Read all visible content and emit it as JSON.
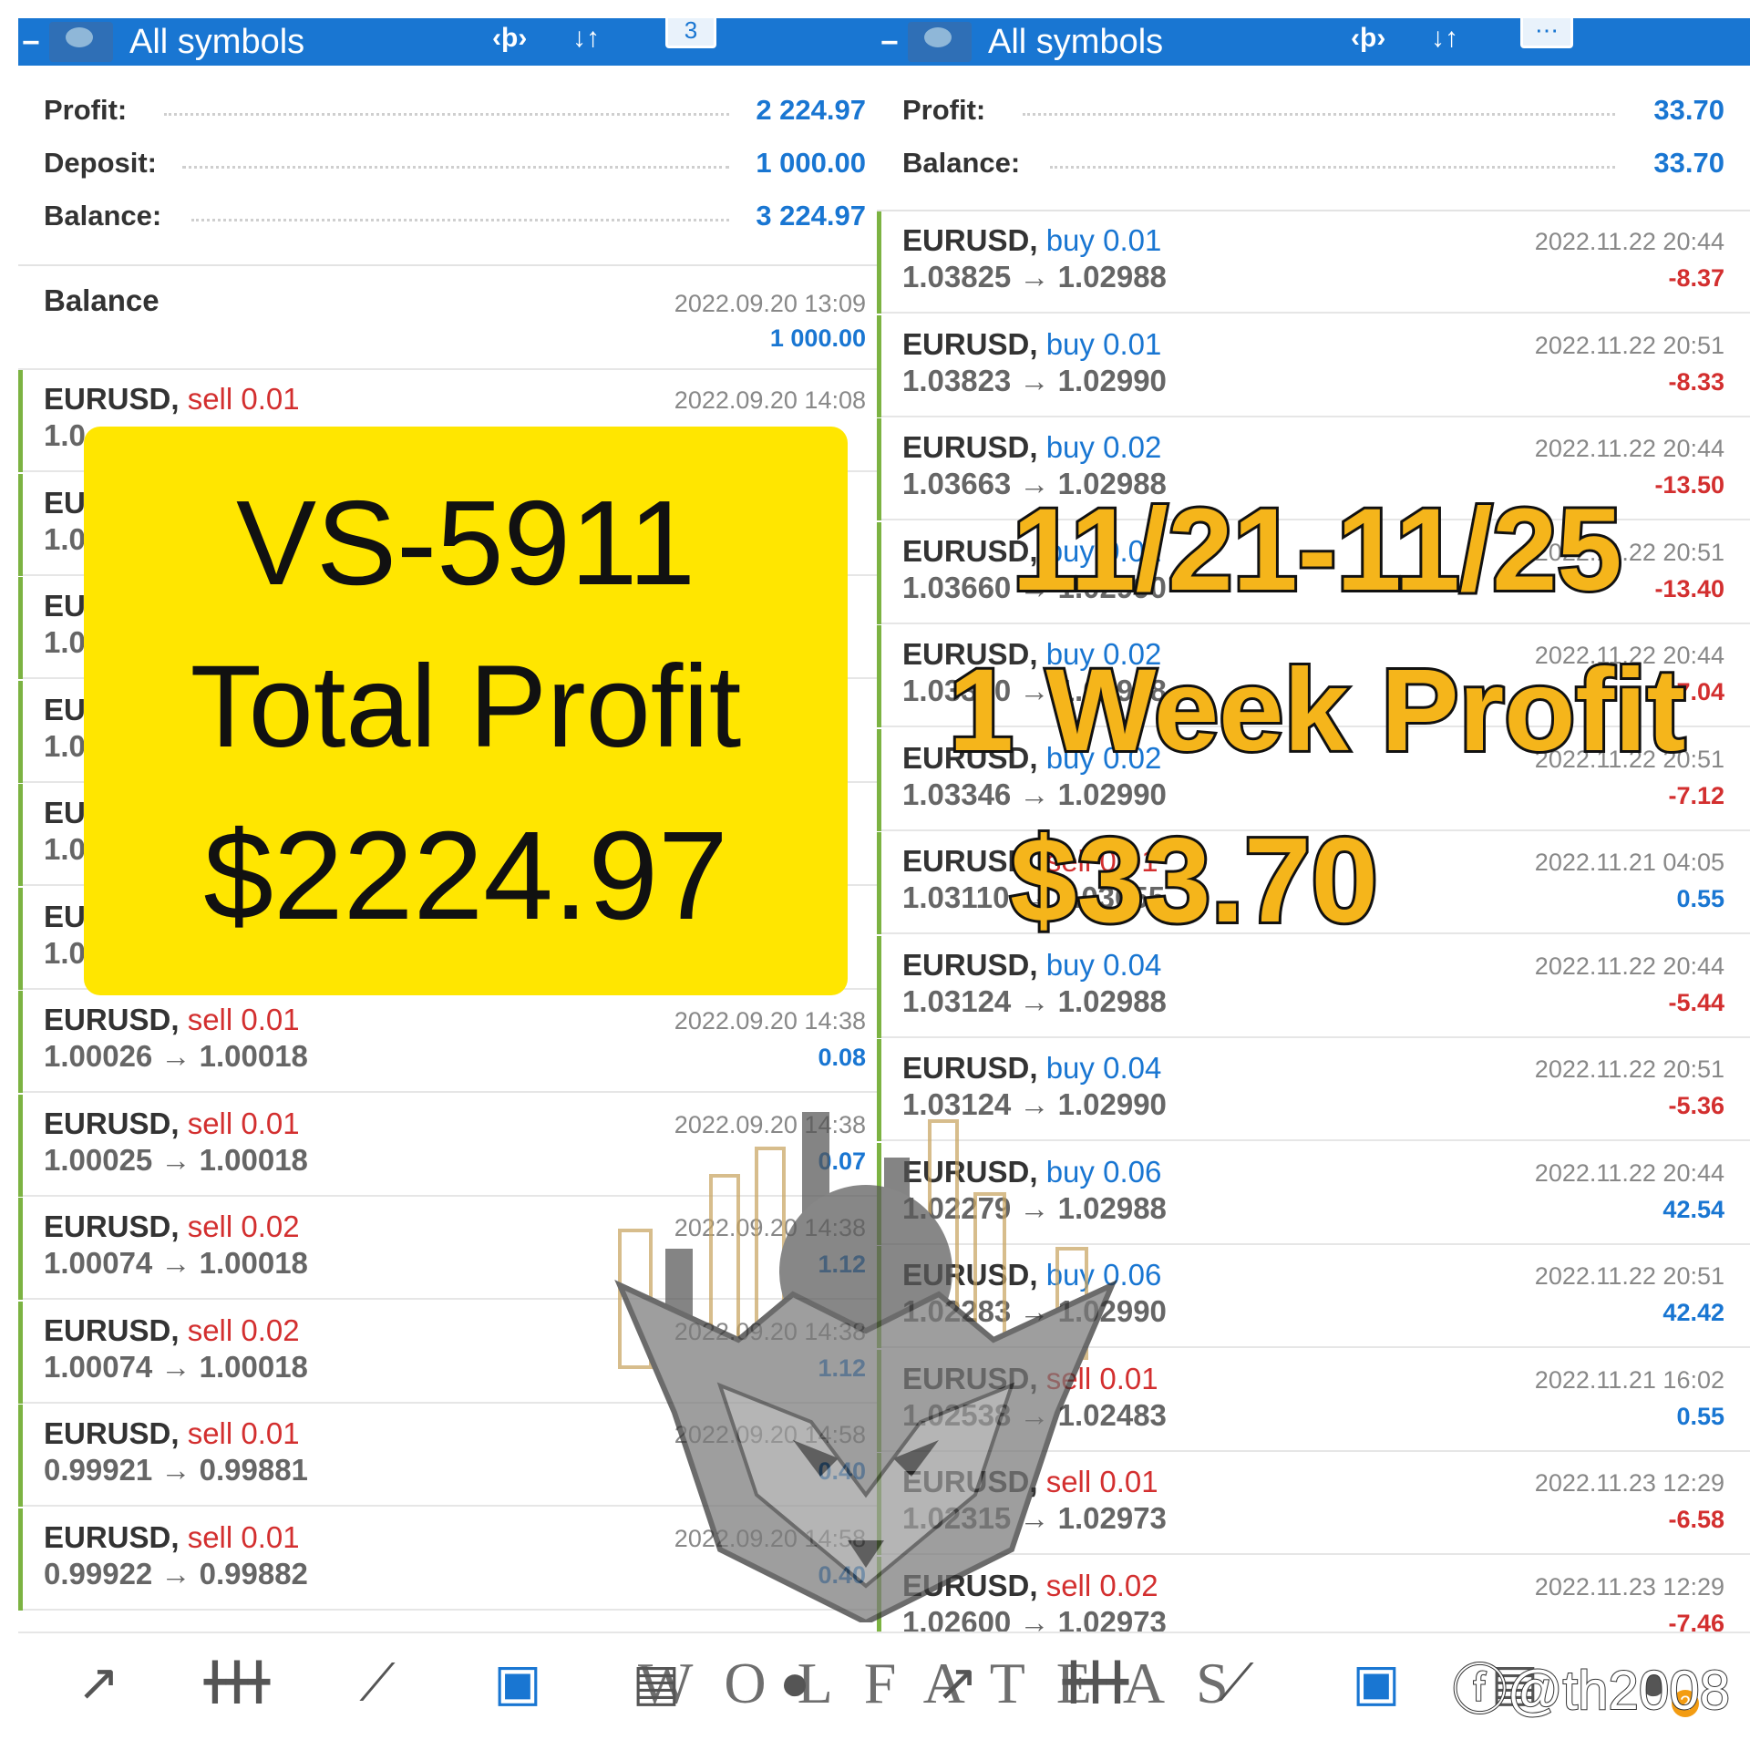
{
  "left": {
    "title": "All symbols",
    "badge": "3",
    "summary": [
      {
        "label": "Profit:",
        "value": "2 224.97"
      },
      {
        "label": "Deposit:",
        "value": "1 000.00"
      },
      {
        "label": "Balance:",
        "value": "3 224.97"
      }
    ],
    "balance_entry": {
      "label": "Balance",
      "time": "2022.09.20 13:09",
      "amount": "1 000.00"
    },
    "rows": [
      {
        "symbol": "EURUSD,",
        "side": "sell",
        "lot": "0.01",
        "prices": "1.0",
        "time": "2022.09.20 14:08",
        "profit": ""
      },
      {
        "symbol": "EU",
        "side": "",
        "lot": "",
        "prices": "1.0",
        "time": "",
        "profit": ""
      },
      {
        "symbol": "EU",
        "side": "",
        "lot": "",
        "prices": "1.0",
        "time": "",
        "profit": ""
      },
      {
        "symbol": "EU",
        "side": "",
        "lot": "",
        "prices": "1.0",
        "time": "",
        "profit": ""
      },
      {
        "symbol": "EU",
        "side": "",
        "lot": "",
        "prices": "1.0",
        "time": "",
        "profit": ""
      },
      {
        "symbol": "EU",
        "side": "",
        "lot": "",
        "prices": "1.0",
        "time": "",
        "profit": ""
      },
      {
        "symbol": "EURUSD,",
        "side": "sell",
        "lot": "0.01",
        "prices": "1.00026 → 1.00018",
        "time": "2022.09.20 14:38",
        "profit": "0.08"
      },
      {
        "symbol": "EURUSD,",
        "side": "sell",
        "lot": "0.01",
        "prices": "1.00025 → 1.00018",
        "time": "2022.09.20 14:38",
        "profit": "0.07"
      },
      {
        "symbol": "EURUSD,",
        "side": "sell",
        "lot": "0.02",
        "prices": "1.00074 → 1.00018",
        "time": "2022.09.20 14:38",
        "profit": "1.12"
      },
      {
        "symbol": "EURUSD,",
        "side": "sell",
        "lot": "0.02",
        "prices": "1.00074 → 1.00018",
        "time": "2022.09.20 14:38",
        "profit": "1.12"
      },
      {
        "symbol": "EURUSD,",
        "side": "sell",
        "lot": "0.01",
        "prices": "0.99921 → 0.99881",
        "time": "2022.09.20 14:58",
        "profit": "0.40"
      },
      {
        "symbol": "EURUSD,",
        "side": "sell",
        "lot": "0.01",
        "prices": "0.99922 → 0.99882",
        "time": "2022.09.20 14:58",
        "profit": "0.40"
      }
    ],
    "nav": [
      "↗",
      "┃┃┃",
      "⟋",
      "▣",
      "▤",
      "●"
    ]
  },
  "right": {
    "title": "All symbols",
    "summary": [
      {
        "label": "Profit:",
        "value": "33.70"
      },
      {
        "label": "Balance:",
        "value": "33.70"
      }
    ],
    "rows": [
      {
        "symbol": "EURUSD,",
        "side": "buy",
        "lot": "0.01",
        "prices": "1.03825 → 1.02988",
        "time": "2022.11.22 20:44",
        "profit": "-8.37"
      },
      {
        "symbol": "EURUSD,",
        "side": "buy",
        "lot": "0.01",
        "prices": "1.03823 → 1.02990",
        "time": "2022.11.22 20:51",
        "profit": "-8.33"
      },
      {
        "symbol": "EURUSD,",
        "side": "buy",
        "lot": "0.02",
        "prices": "1.03663 → 1.02988",
        "time": "2022.11.22 20:44",
        "profit": "-13.50"
      },
      {
        "symbol": "EURUSD,",
        "side": "buy",
        "lot": "0.02",
        "prices": "1.03660 → 1.02990",
        "time": "2022.11.22 20:51",
        "profit": "-13.40"
      },
      {
        "symbol": "EURUSD,",
        "side": "buy",
        "lot": "0.02",
        "prices": "1.03340 → 1.02988",
        "time": "2022.11.22 20:44",
        "profit": "-7.04"
      },
      {
        "symbol": "EURUSD,",
        "side": "buy",
        "lot": "0.02",
        "prices": "1.03346 → 1.02990",
        "time": "2022.11.22 20:51",
        "profit": "-7.12"
      },
      {
        "symbol": "EURUSD,",
        "side": "sell",
        "lot": "0.01",
        "prices": "1.03110 → 1.03055",
        "time": "2022.11.21 04:05",
        "profit": "0.55"
      },
      {
        "symbol": "EURUSD,",
        "side": "buy",
        "lot": "0.04",
        "prices": "1.03124 → 1.02988",
        "time": "2022.11.22 20:44",
        "profit": "-5.44"
      },
      {
        "symbol": "EURUSD,",
        "side": "buy",
        "lot": "0.04",
        "prices": "1.03124 → 1.02990",
        "time": "2022.11.22 20:51",
        "profit": "-5.36"
      },
      {
        "symbol": "EURUSD,",
        "side": "buy",
        "lot": "0.06",
        "prices": "1.02279 → 1.02988",
        "time": "2022.11.22 20:44",
        "profit": "42.54"
      },
      {
        "symbol": "EURUSD,",
        "side": "buy",
        "lot": "0.06",
        "prices": "1.02283 → 1.02990",
        "time": "2022.11.22 20:51",
        "profit": "42.42"
      },
      {
        "symbol": "EURUSD,",
        "side": "sell",
        "lot": "0.01",
        "prices": "1.02538 → 1.02483",
        "time": "2022.11.21 16:02",
        "profit": "0.55"
      },
      {
        "symbol": "EURUSD,",
        "side": "sell",
        "lot": "0.01",
        "prices": "1.02315 → 1.02973",
        "time": "2022.11.23 12:29",
        "profit": "-6.58"
      },
      {
        "symbol": "EURUSD,",
        "side": "sell",
        "lot": "0.02",
        "prices": "1.02600 → 1.02973",
        "time": "2022.11.23 12:29",
        "profit": "-7.46"
      }
    ],
    "nav": [
      "↗",
      "┃┃┃",
      "⟋",
      "▣",
      "▤",
      "●"
    ]
  },
  "overlay_left": {
    "line1": "VS-5911",
    "line2": "Total Profit",
    "line3": "$2224.97"
  },
  "overlay_right": {
    "line1": "11/21-11/25",
    "line2": "1 Week Profit",
    "line3": "$33.70"
  },
  "watermark_text": "WOLFATEAS",
  "handle": "@th2008",
  "notif_count": "2",
  "colors": {
    "header": "#1976d2",
    "positive": "#1976d2",
    "negative": "#d32f2f",
    "accent_bar": "#7cb342",
    "highlight": "#ffe600",
    "overlay_text": "#f5b51b"
  }
}
